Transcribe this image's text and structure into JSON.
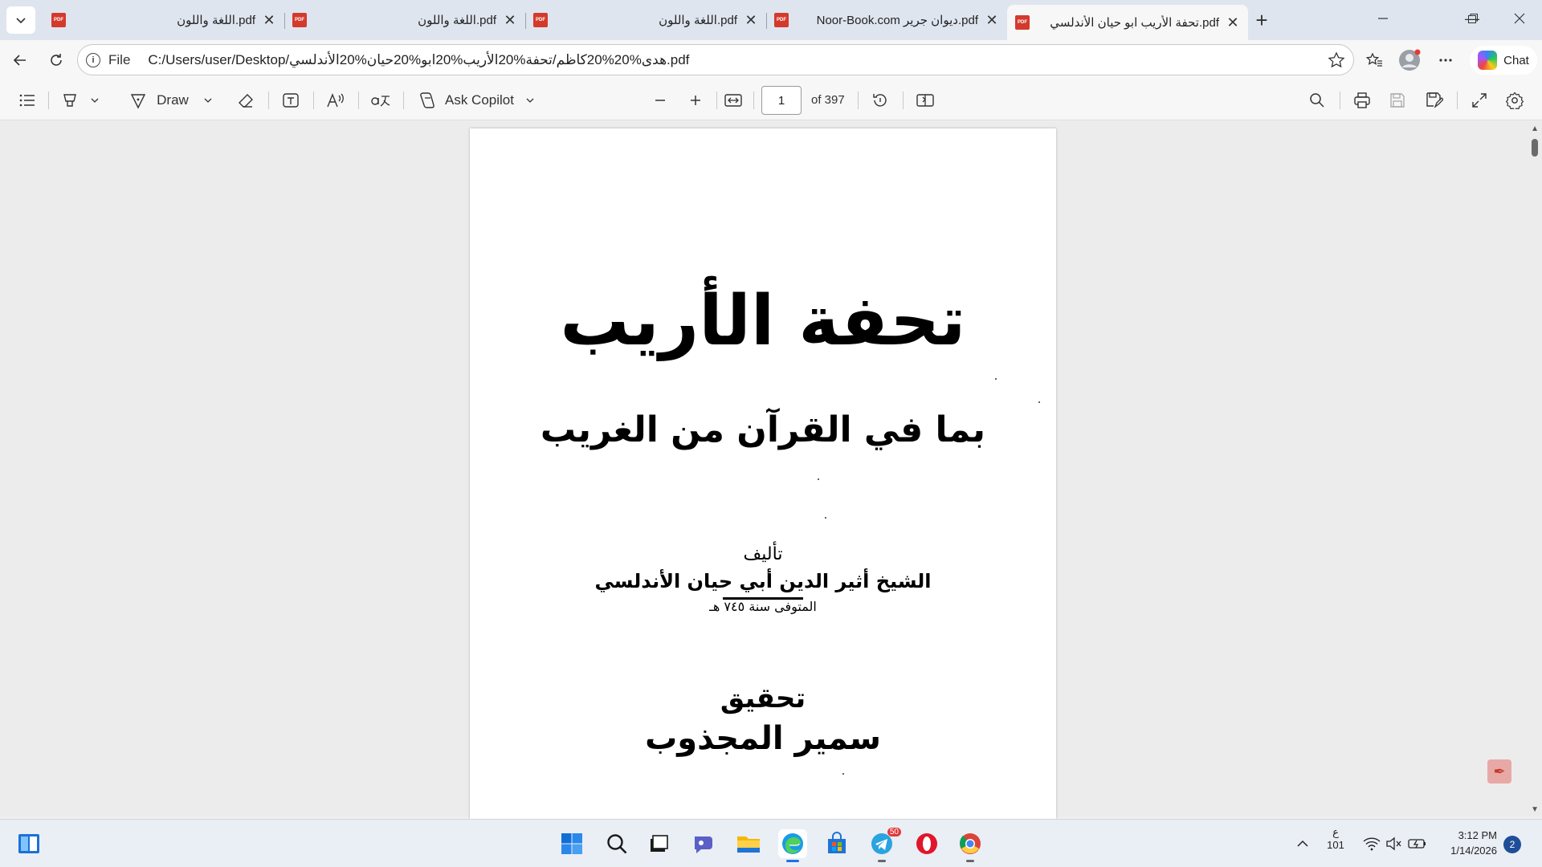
{
  "browser": {
    "tabs": [
      {
        "title": "اللغة واللون.pdf",
        "active": false
      },
      {
        "title": "اللغة واللون.pdf",
        "active": false
      },
      {
        "title": "اللغة واللون.pdf",
        "active": false
      },
      {
        "title": "Noor-Book.com ديوان جرير.pdf",
        "active": false
      },
      {
        "title": "تحفة الأريب ابو حيان الأندلسي.pdf",
        "active": true
      }
    ],
    "pdf_icon_label": "PDF",
    "tab_close_glyph": "✕",
    "new_tab_glyph": "+",
    "window": {
      "minimize": "—",
      "maximize": "❐",
      "close": "✕"
    }
  },
  "address": {
    "scheme": "File",
    "url": "C:/Users/user/Desktop/هدى%20%20كاظم/تحفة%20الأريب%20ابو%20حيان%20الأندلسي.pdf",
    "chat_label": "Chat"
  },
  "pdf_toolbar": {
    "draw_label": "Draw",
    "copilot_label": "Ask Copilot",
    "page_current": "1",
    "page_total_label": "of 397"
  },
  "document": {
    "title": "تحفة الأريب",
    "subtitle": "بما في القرآن من الغريب",
    "by_label": "تأليف",
    "author": "الشيخ أثير الدين أبي حيان الأندلسي",
    "died": "المتوفى سنة ٧٤٥ هـ",
    "edited_label": "تحقيق",
    "editor": "سمير المجذوب"
  },
  "taskbar": {
    "telegram_badge": "50",
    "lang_top": "ع",
    "lang_bottom": "101",
    "time": "3:12 PM",
    "date": "1/14/2026",
    "notifications": "2"
  }
}
